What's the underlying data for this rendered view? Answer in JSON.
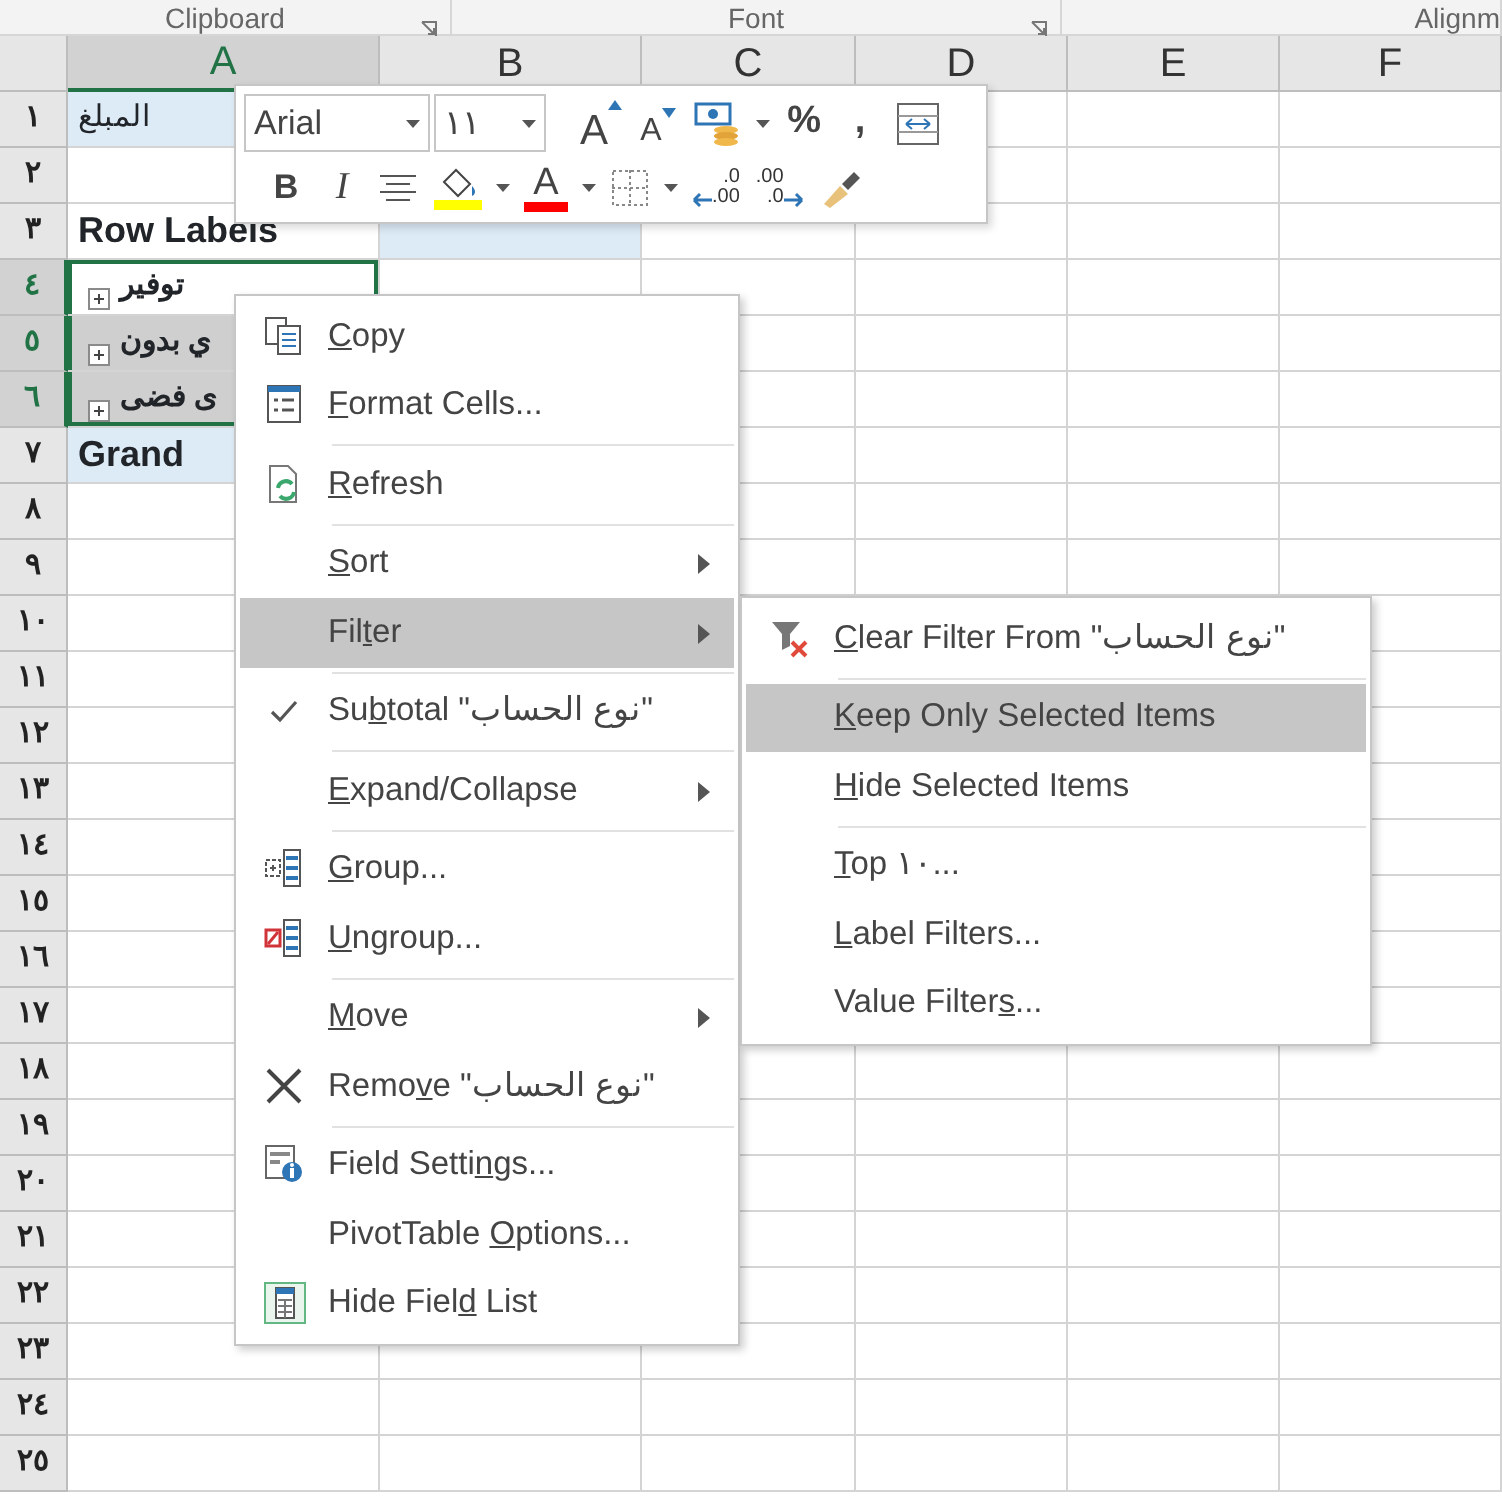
{
  "ribbon_groups": [
    {
      "label": "Clipboard",
      "launcher": true
    },
    {
      "label": "Font",
      "launcher": true
    },
    {
      "label": "Alignm",
      "launcher": false
    }
  ],
  "columns": [
    {
      "label": "A",
      "selected": true
    },
    {
      "label": "B",
      "selected": false
    },
    {
      "label": "C",
      "selected": false
    },
    {
      "label": "D",
      "selected": false
    },
    {
      "label": "E",
      "selected": false
    },
    {
      "label": "F",
      "selected": false
    }
  ],
  "rows": [
    {
      "label": "١",
      "selected": false,
      "cells": [
        {
          "kind": "field-header",
          "text": "المبلغ"
        }
      ]
    },
    {
      "label": "٢",
      "selected": false,
      "cells": []
    },
    {
      "label": "٣",
      "selected": false,
      "cells": [
        {
          "kind": "label-header",
          "text": "Row Labels"
        },
        {
          "kind": "value-header"
        }
      ]
    },
    {
      "label": "٤",
      "selected": true,
      "cells": [
        {
          "kind": "item",
          "text": "توفير",
          "selected": true,
          "active": true
        }
      ]
    },
    {
      "label": "٥",
      "selected": true,
      "cells": [
        {
          "kind": "item",
          "text": "ي بدون",
          "selected": true,
          "active": false
        }
      ]
    },
    {
      "label": "٦",
      "selected": true,
      "cells": [
        {
          "kind": "item",
          "text": "ى فضى",
          "selected": true,
          "active": false
        }
      ]
    },
    {
      "label": "٧",
      "selected": false,
      "cells": [
        {
          "kind": "grand-total",
          "text": "Grand"
        }
      ]
    },
    {
      "label": "٨",
      "selected": false,
      "cells": []
    },
    {
      "label": "٩",
      "selected": false,
      "cells": []
    },
    {
      "label": "١٠",
      "selected": false,
      "cells": []
    },
    {
      "label": "١١",
      "selected": false,
      "cells": []
    },
    {
      "label": "١٢",
      "selected": false,
      "cells": []
    },
    {
      "label": "١٣",
      "selected": false,
      "cells": []
    },
    {
      "label": "١٤",
      "selected": false,
      "cells": []
    },
    {
      "label": "١٥",
      "selected": false,
      "cells": []
    },
    {
      "label": "١٦",
      "selected": false,
      "cells": []
    },
    {
      "label": "١٧",
      "selected": false,
      "cells": []
    },
    {
      "label": "١٨",
      "selected": false,
      "cells": []
    },
    {
      "label": "١٩",
      "selected": false,
      "cells": []
    },
    {
      "label": "٢٠",
      "selected": false,
      "cells": []
    },
    {
      "label": "٢١",
      "selected": false,
      "cells": []
    },
    {
      "label": "٢٢",
      "selected": false,
      "cells": []
    },
    {
      "label": "٢٣",
      "selected": false,
      "cells": []
    },
    {
      "label": "٢٤",
      "selected": false,
      "cells": []
    },
    {
      "label": "٢٥",
      "selected": false,
      "cells": []
    }
  ],
  "mini_toolbar": {
    "font_box": {
      "value": "Arial"
    },
    "size_box": {
      "value": "١١"
    },
    "top_buttons": [
      {
        "kind": "grow-font",
        "label": "A",
        "dropdown": false
      },
      {
        "kind": "shrink-font",
        "label": "A",
        "dropdown": false
      },
      {
        "kind": "accounting",
        "dropdown": true
      },
      {
        "kind": "percent",
        "label": "%",
        "dropdown": false
      },
      {
        "kind": "comma",
        "label": ",",
        "dropdown": false
      },
      {
        "kind": "merge",
        "dropdown": false
      }
    ],
    "bottom_buttons": [
      {
        "kind": "bold",
        "label": "B",
        "dropdown": false
      },
      {
        "kind": "italic",
        "label": "I",
        "dropdown": false
      },
      {
        "kind": "center",
        "dropdown": false
      },
      {
        "kind": "fill-color",
        "color": "#ffff00",
        "dropdown": true
      },
      {
        "kind": "font-color",
        "label": "A",
        "color": "#ff0000",
        "dropdown": true
      },
      {
        "kind": "borders",
        "dropdown": true
      },
      {
        "kind": "increase-decimal",
        "top": ".0",
        "bottom": ".00",
        "dropdown": false
      },
      {
        "kind": "decrease-decimal",
        "top": ".00",
        "bottom": ".0",
        "dropdown": false
      },
      {
        "kind": "format-painter",
        "dropdown": false
      }
    ]
  },
  "context_menu": [
    {
      "kind": "copy",
      "key": "C",
      "after": "opy",
      "checked": false,
      "submenu": false,
      "selected": false
    },
    {
      "kind": "format-cells",
      "key": "F",
      "after": "ormat Cells...",
      "checked": false,
      "submenu": false,
      "selected": false
    },
    {
      "kind": "separator"
    },
    {
      "kind": "refresh",
      "key": "R",
      "after": "efresh",
      "checked": false,
      "submenu": false,
      "selected": false
    },
    {
      "kind": "separator"
    },
    {
      "kind": "item",
      "key": "S",
      "after": "ort",
      "checked": false,
      "submenu": true,
      "selected": false
    },
    {
      "kind": "item",
      "before": "Fil",
      "key": "t",
      "after": "er",
      "checked": false,
      "submenu": true,
      "selected": true
    },
    {
      "kind": "separator"
    },
    {
      "kind": "item",
      "before": "Su",
      "key": "b",
      "after": "total \"نوع الحساب\"",
      "checked": true,
      "submenu": false,
      "selected": false
    },
    {
      "kind": "separator"
    },
    {
      "kind": "item",
      "key": "E",
      "after": "xpand/Collapse",
      "checked": false,
      "submenu": true,
      "selected": false
    },
    {
      "kind": "separator"
    },
    {
      "kind": "group",
      "key": "G",
      "after": "roup...",
      "checked": false,
      "submenu": false,
      "selected": false
    },
    {
      "kind": "ungroup",
      "key": "U",
      "after": "ngroup...",
      "checked": false,
      "submenu": false,
      "selected": false
    },
    {
      "kind": "separator"
    },
    {
      "kind": "item",
      "key": "M",
      "after": "ove",
      "checked": false,
      "submenu": true,
      "selected": false
    },
    {
      "kind": "remove",
      "before": "Remo",
      "key": "v",
      "after": "e \"نوع الحساب\"",
      "checked": false,
      "submenu": false,
      "selected": false
    },
    {
      "kind": "separator"
    },
    {
      "kind": "field-settings",
      "before": "Field Setti",
      "key": "n",
      "after": "gs...",
      "checked": false,
      "submenu": false,
      "selected": false
    },
    {
      "kind": "item",
      "before": "PivotTable ",
      "key": "O",
      "after": "ptions...",
      "checked": false,
      "submenu": false,
      "selected": false
    },
    {
      "kind": "field-list",
      "before": "Hide Fiel",
      "key": "d",
      "after": " List",
      "checked": false,
      "submenu": false,
      "selected": false
    }
  ],
  "filter_submenu": [
    {
      "kind": "clear-filter",
      "key": "C",
      "after": "lear Filter From \"نوع الحساب\"",
      "selected": false
    },
    {
      "kind": "separator"
    },
    {
      "kind": "item",
      "key": "K",
      "after": "eep Only Selected Items",
      "selected": true
    },
    {
      "kind": "item",
      "key": "H",
      "after": "ide Selected Items",
      "selected": false
    },
    {
      "kind": "separator"
    },
    {
      "kind": "item",
      "key": "T",
      "after": "op ١٠...",
      "selected": false
    },
    {
      "kind": "item",
      "key": "L",
      "after": "abel Filters...",
      "selected": false
    },
    {
      "kind": "item",
      "before": "Value Filter",
      "key": "s",
      "after": "...",
      "selected": false
    }
  ]
}
